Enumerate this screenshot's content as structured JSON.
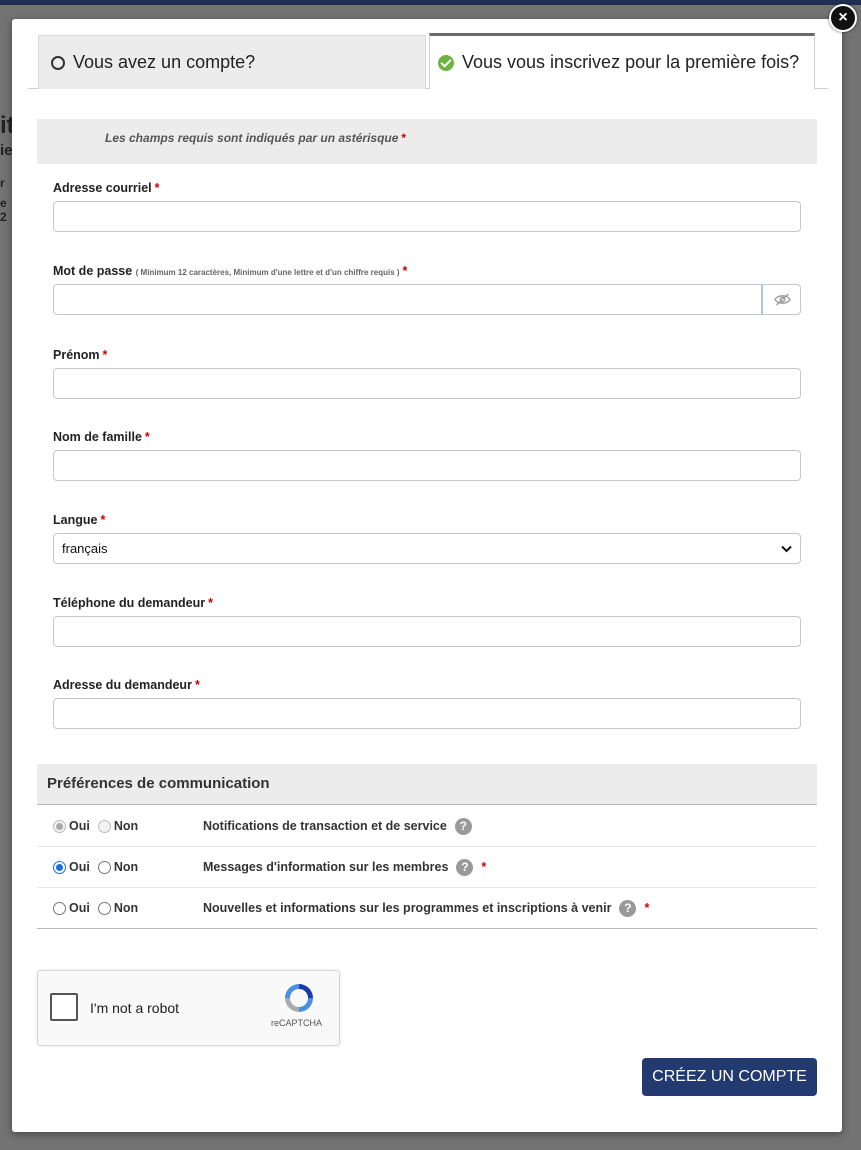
{
  "backdrop": {
    "heading_fragment": "it",
    "sub_fragment": "ie",
    "line3_fragment": "r",
    "line4_fragment": "e 2"
  },
  "modal": {
    "close_icon": "×"
  },
  "tabs": {
    "login_label": "Vous avez un compte?",
    "register_label": "Vous vous inscrivez pour la première fois?"
  },
  "required_note": {
    "text": "Les champs requis sont indiqués par un astérisque",
    "star": "*"
  },
  "fields": {
    "email": {
      "label": "Adresse courriel",
      "star": "*",
      "value": ""
    },
    "password": {
      "label": "Mot de passe",
      "hint": "( Minimum 12 caractères, Minimum d'une lettre et d'un chiffre requis )",
      "star": "*",
      "value": ""
    },
    "first_name": {
      "label": "Prénom",
      "star": "*",
      "value": ""
    },
    "last_name": {
      "label": "Nom de famille",
      "star": "*",
      "value": ""
    },
    "language": {
      "label": "Langue",
      "star": "*",
      "selected": "français"
    },
    "phone": {
      "label": "Téléphone du demandeur",
      "star": "*",
      "value": ""
    },
    "address": {
      "label": "Adresse du demandeur",
      "star": "*",
      "value": ""
    }
  },
  "preferences": {
    "header": "Préférences de communication",
    "yes_label": "Oui",
    "no_label": "Non",
    "rows": [
      {
        "label": "Notifications de transaction et de service",
        "star": "",
        "selected": "yes",
        "disabled": true
      },
      {
        "label": "Messages d'information sur les membres",
        "star": "*",
        "selected": "yes",
        "disabled": false
      },
      {
        "label": "Nouvelles et informations sur les programmes et inscriptions à venir",
        "star": "*",
        "selected": "none",
        "disabled": false
      }
    ],
    "help_icon": "?"
  },
  "captcha": {
    "label": "I'm not a robot",
    "brand": "reCAPTCHA"
  },
  "submit": {
    "label": "CRÉEZ UN COMPTE"
  },
  "colors": {
    "primary": "#223a70",
    "required": "#cc0000",
    "check_green": "#6cb33f"
  }
}
